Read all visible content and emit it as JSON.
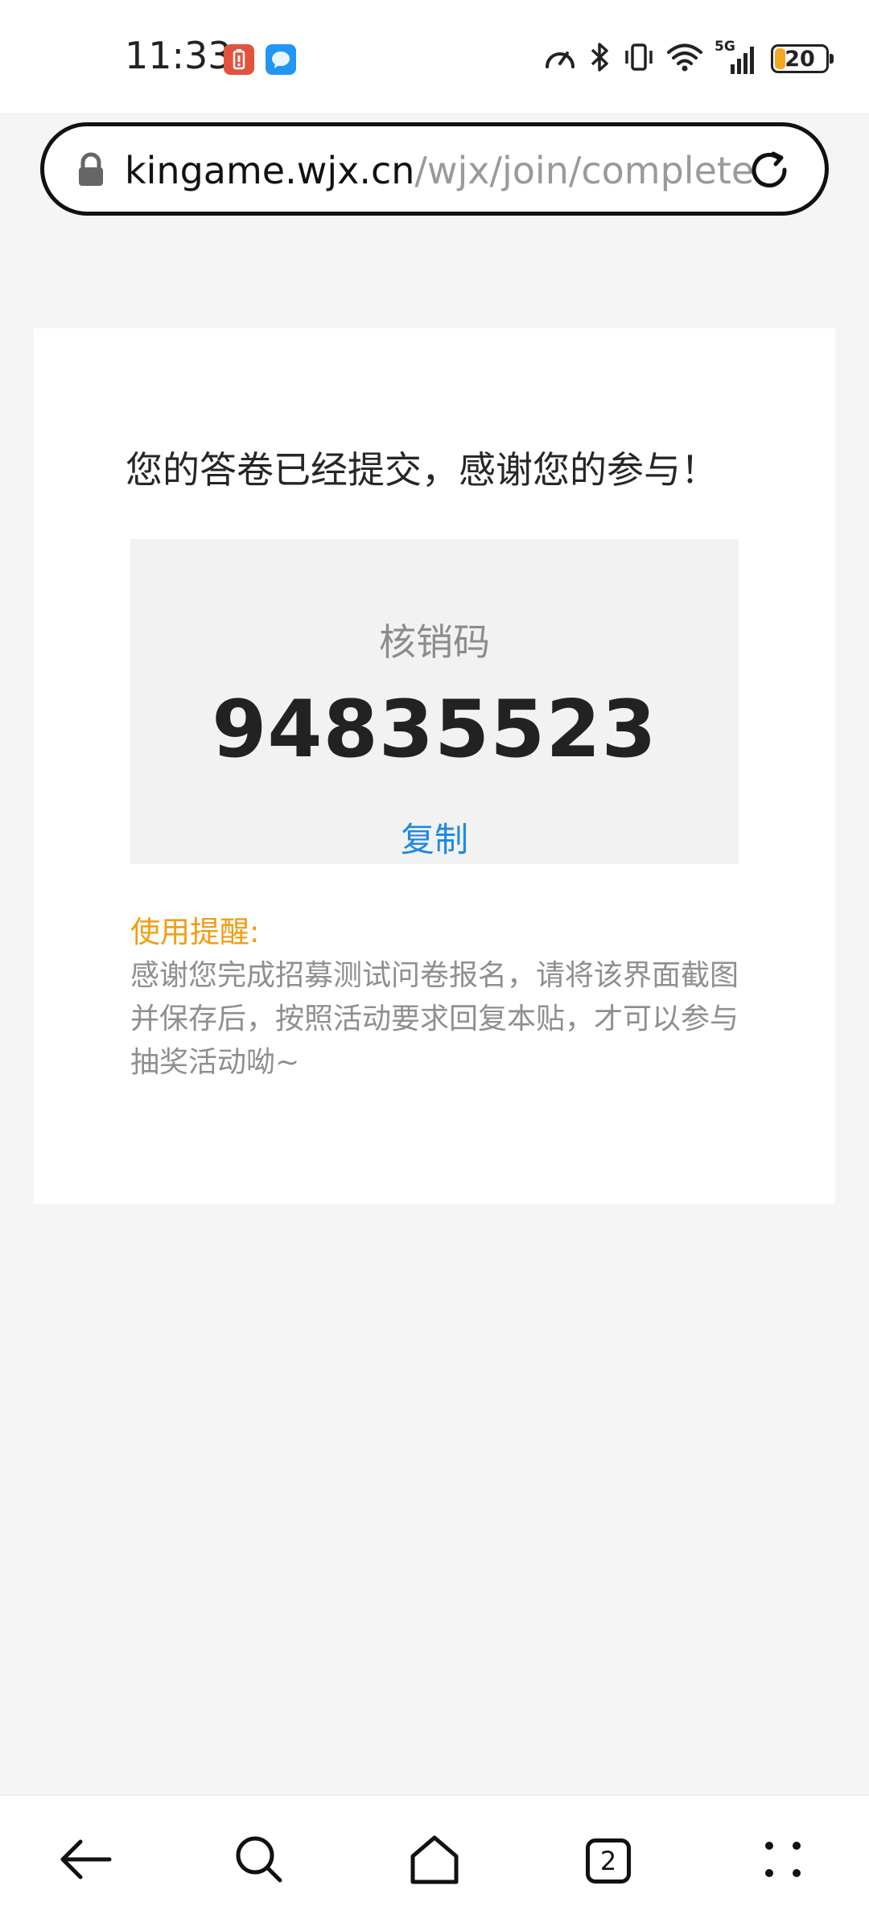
{
  "status_bar": {
    "time": "11:33",
    "network": "5G",
    "battery": "20",
    "battery_color": "#f5a623",
    "icons": [
      "speed-icon",
      "bluetooth-icon",
      "vibrate-icon",
      "wifi-icon",
      "signal-icon",
      "battery-icon"
    ],
    "notification_icons": [
      "battery-alert-app-icon",
      "messenger-app-icon"
    ]
  },
  "browser": {
    "url_domain": "kingame.wjx.cn",
    "url_path": "/wjx/join/complete",
    "lock_icon": "lock-icon",
    "reload_icon": "reload-icon"
  },
  "page": {
    "title": "您的答卷已经提交，感谢您的参与！",
    "code_label": "核销码",
    "code_value": "94835523",
    "copy_label": "复制",
    "tip_title": "使用提醒:",
    "tip_body": "感谢您完成招募测试问卷报名，请将该界面截图并保存后，按照活动要求回复本贴，才可以参与抽奖活动呦~",
    "accent_color": "#1e88e5",
    "tip_color": "#f39c12"
  },
  "bottom_nav": {
    "tab_count": "2",
    "items": [
      "back-icon",
      "search-icon",
      "home-icon",
      "tabs-icon",
      "menu-icon"
    ]
  }
}
